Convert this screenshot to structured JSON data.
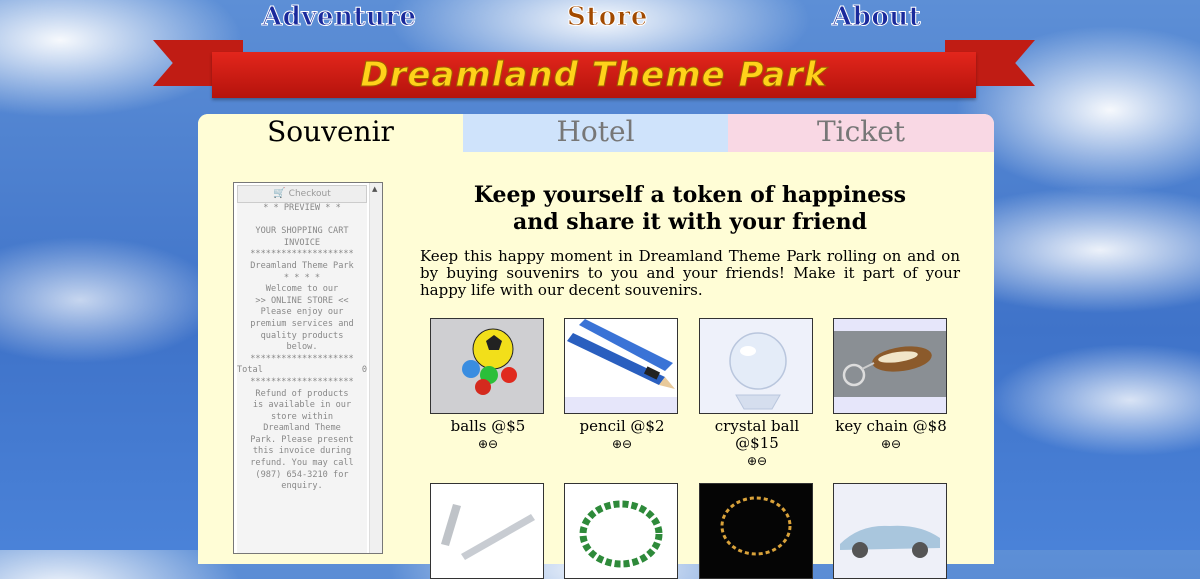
{
  "nav": {
    "adventure": "Adventure",
    "store": "Store",
    "about": "About"
  },
  "banner": {
    "title": "Dreamland Theme Park"
  },
  "tabs": {
    "souvenir": "Souvenir",
    "hotel": "Hotel",
    "ticket": "Ticket"
  },
  "cart": {
    "checkout_label": "Checkout",
    "invoice_top": "* * PREVIEW * *\n\nYOUR SHOPPING CART\nINVOICE\n********************\nDreamland Theme Park\n* * * *\nWelcome to our\n>> ONLINE STORE <<\nPlease enjoy our\npremium services and\nquality products\nbelow.\n********************\n",
    "total_label": "Total",
    "total_value": "0",
    "invoice_bottom": "********************\nRefund of products\nis available in our\nstore within\nDreamland Theme\nPark. Please present\nthis invoice during\nrefund. You may call\n(987) 654-3210 for\nenquiry."
  },
  "content": {
    "heading_line1": "Keep yourself a token of happiness",
    "heading_line2": "and share it with your friend",
    "intro": "Keep this happy moment in Dreamland Theme Park rolling on and on by buying souvenirs to you and your friends! Make it part of your happy life with our decent souvenirs."
  },
  "products": [
    {
      "name": "balls @$5",
      "add": "⊕",
      "remove": "⊖"
    },
    {
      "name": "pencil @$2",
      "add": "⊕",
      "remove": "⊖"
    },
    {
      "name": "crystal ball @$15",
      "add": "⊕",
      "remove": "⊖"
    },
    {
      "name": "key chain @$8",
      "add": "⊕",
      "remove": "⊖"
    }
  ]
}
